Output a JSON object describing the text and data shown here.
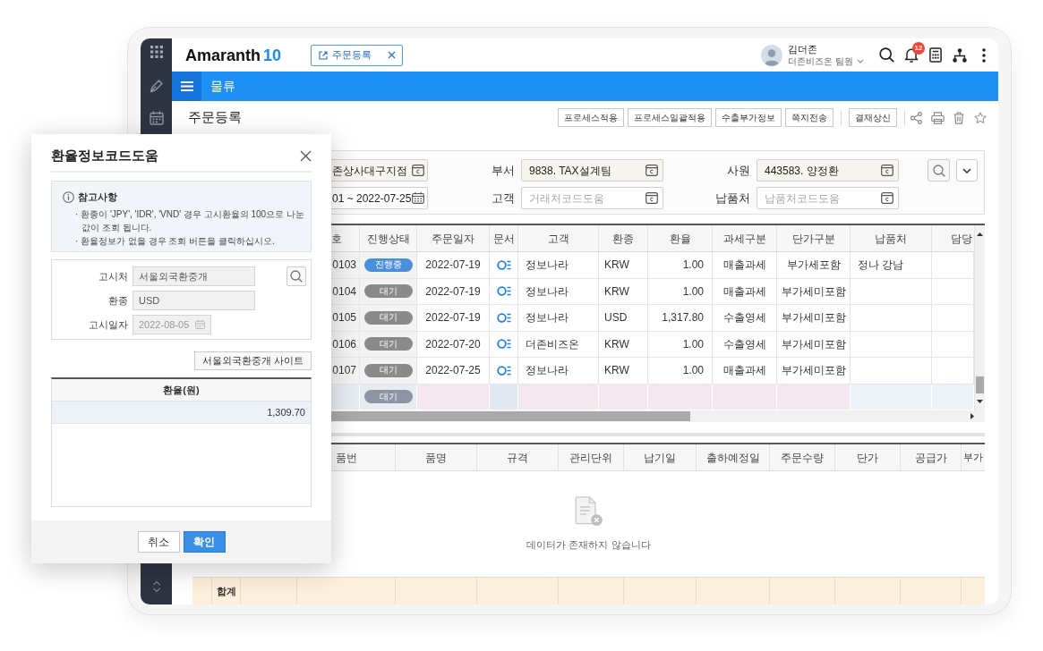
{
  "header": {
    "logo": {
      "wordmark": "Amaranth",
      "version": "10"
    },
    "open_tab": {
      "label": "주문등록"
    },
    "user": {
      "name": "김더존",
      "role": "더존비즈온 팀원"
    },
    "notification_count": "12"
  },
  "menu_bar": {
    "title": "물류"
  },
  "page": {
    "title": "주문등록",
    "action_groups": [
      [
        "프로세스적용",
        "프로세스일괄적용",
        "수출부가정보",
        "쪽지전송"
      ],
      [
        "결재상신"
      ]
    ]
  },
  "filters": [
    [
      {
        "kind": "lookup",
        "required": true,
        "value": "존상사대구지점"
      },
      {
        "kind": "lookup",
        "required": true,
        "label": "부서",
        "value": "9838. TAX설계팀"
      },
      {
        "kind": "lookup",
        "required": true,
        "label": "사원",
        "value": "443583. 양정환"
      }
    ],
    [
      {
        "kind": "date",
        "required": false,
        "value": "01 ~ 2022-07-25"
      },
      {
        "kind": "lookup",
        "required": false,
        "label": "고객",
        "placeholder": "거래처코드도움"
      },
      {
        "kind": "lookup",
        "required": false,
        "label": "납품처",
        "placeholder": "납품처코드도움"
      }
    ]
  ],
  "order_table": {
    "columns": [
      "호",
      "진행상태",
      "주문일자",
      "문서",
      "고객",
      "환종",
      "환율",
      "과세구분",
      "단가구분",
      "납품처",
      "담당"
    ],
    "rows": [
      {
        "kind": "data",
        "number": "0103",
        "status": {
          "label": "진행중",
          "color": "#4a8fdc"
        },
        "order_date": "2022-07-19",
        "document": true,
        "customer": "정보나라",
        "currency": "KRW",
        "exchange_rate": "1.00",
        "tax_type": "매출과세",
        "price_type": "부가세포함",
        "delivery_place": "정나 강남"
      },
      {
        "kind": "data",
        "number": "0104",
        "status": {
          "label": "대기",
          "color": "#8a8a8a"
        },
        "order_date": "2022-07-19",
        "document": true,
        "customer": "정보나라",
        "currency": "KRW",
        "exchange_rate": "1.00",
        "tax_type": "매출과세",
        "price_type": "부가세미포함"
      },
      {
        "kind": "data",
        "number": "0105",
        "status": {
          "label": "대기",
          "color": "#8a8a8a"
        },
        "order_date": "2022-07-19",
        "document": true,
        "customer": "정보나라",
        "currency": "USD",
        "exchange_rate": "1,317.80",
        "tax_type": "수출영세",
        "price_type": "부가세미포함"
      },
      {
        "kind": "data",
        "number": "0106",
        "status": {
          "label": "대기",
          "color": "#8a8a8a"
        },
        "order_date": "2022-07-20",
        "document": true,
        "customer": "더존비즈온",
        "currency": "KRW",
        "exchange_rate": "1.00",
        "tax_type": "수출영세",
        "price_type": "부가세미포함"
      },
      {
        "kind": "data",
        "number": "0107",
        "status": {
          "label": "대기",
          "color": "#8a8a8a"
        },
        "order_date": "2022-07-25",
        "document": true,
        "customer": "정보나라",
        "currency": "KRW",
        "exchange_rate": "1.00",
        "tax_type": "매출과세",
        "price_type": "부가세미포함"
      },
      {
        "kind": "new",
        "status": {
          "label": "대기",
          "color": "#8c95a4"
        },
        "document": false
      }
    ]
  },
  "item_table": {
    "columns": [
      "품번",
      "품명",
      "규격",
      "관리단위",
      "납기일",
      "출하예정일",
      "주문수량",
      "단가",
      "공급가",
      "부가"
    ],
    "empty_message": "데이터가 존재하지 않습니다",
    "summary_label": "합계"
  },
  "dialog": {
    "title": "환율정보코드도움",
    "notes_title": "참고사항",
    "notes": [
      "· 환종이 'JPY', 'IDR', 'VND' 경우 고시환율의 100으로 나눈 값이 조회 됩니다.",
      "· 환율정보가 없을 경우 조회 버튼을 클릭하십시오."
    ],
    "fields": [
      {
        "kind": "lookup",
        "readonly": true,
        "label": "고시처",
        "value": "서울외국환중개"
      },
      {
        "kind": "text",
        "readonly": true,
        "label": "환종",
        "value": "USD"
      },
      {
        "kind": "date",
        "readonly": true,
        "label": "고시일자",
        "value": "2022-08-05"
      }
    ],
    "site_button": "서울외국환중개 사이트",
    "grid": {
      "columns": [
        "환율(원)"
      ],
      "rows": [
        {
          "selected": true,
          "cells": [
            "1,309.70"
          ]
        }
      ]
    },
    "buttons": [
      {
        "kind": "secondary",
        "label": "취소"
      },
      {
        "kind": "primary",
        "label": "확인"
      }
    ]
  }
}
